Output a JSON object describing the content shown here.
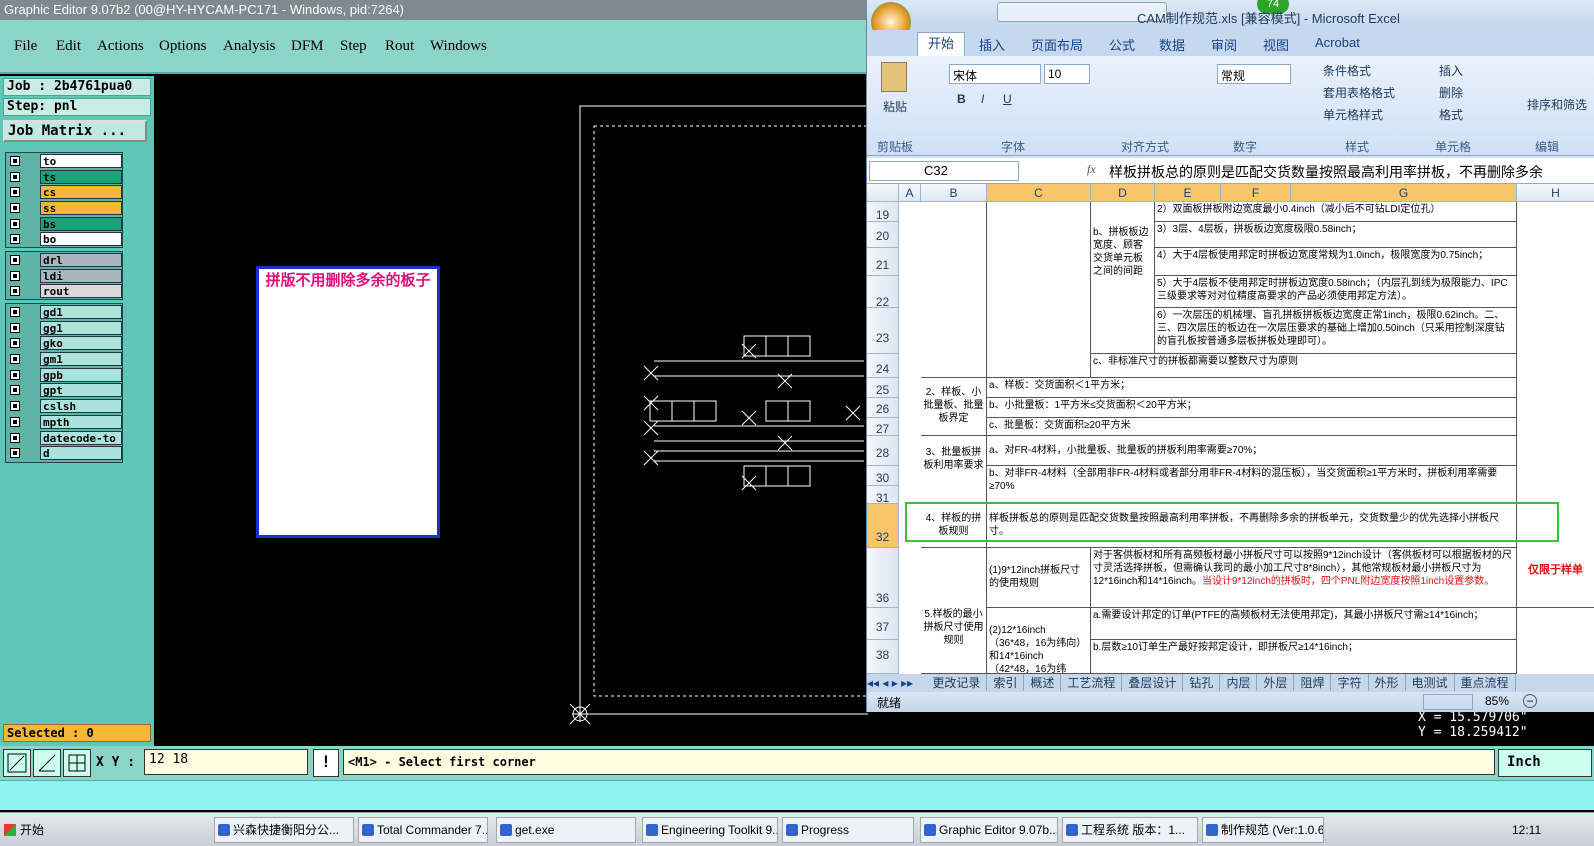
{
  "ge": {
    "title": "Graphic Editor 9.07b2 (00@HY-HYCAM-PC171 - Windows, pid:7264)",
    "menu": [
      "File",
      "Edit",
      "Actions",
      "Options",
      "Analysis",
      "DFM",
      "Step",
      "Rout",
      "Windows"
    ],
    "job": "Job : 2b4761pua0",
    "step": "Step: pnl",
    "job_matrix": "Job Matrix ...",
    "layers_group1": [
      {
        "name": "to",
        "color": "#ffffff"
      },
      {
        "name": "ts",
        "color": "#1aa37a"
      },
      {
        "name": "cs",
        "color": "#f5b836"
      },
      {
        "name": "ss",
        "color": "#f5b836"
      },
      {
        "name": "bs",
        "color": "#1aa37a"
      },
      {
        "name": "bo",
        "color": "#ffffff"
      }
    ],
    "layers_group2": [
      {
        "name": "drl",
        "color": "#a9b6bd"
      },
      {
        "name": "ldi",
        "color": "#a9b6bd"
      },
      {
        "name": "rout",
        "color": "#d8d8d8"
      }
    ],
    "layers_group3": [
      {
        "name": "gd1",
        "color": "#a9e3dc"
      },
      {
        "name": "gg1",
        "color": "#a9e3dc"
      },
      {
        "name": "gko",
        "color": "#a9e3dc"
      },
      {
        "name": "gm1",
        "color": "#a9e3dc"
      },
      {
        "name": "gpb",
        "color": "#a9e3dc"
      },
      {
        "name": "gpt",
        "color": "#a9e3dc"
      },
      {
        "name": "cslsh",
        "color": "#a9e3dc"
      },
      {
        "name": "mpth",
        "color": "#a9e3dc"
      },
      {
        "name": "datecode-to",
        "color": "#a9e3dc"
      },
      {
        "name": "d",
        "color": "#a9e3dc"
      }
    ],
    "selected": "Selected : 0",
    "note_text": "拼版不用删除多余的板子",
    "xy_label": "X Y :",
    "xy_value": "12  18",
    "prompt": "<M1> - Select first corner",
    "unit": "Inch",
    "coord_x": "X = 15.579706\"",
    "coord_y": "Y = 18.259412\""
  },
  "excel": {
    "title": "CAM制作规范.xls  [兼容模式] - Microsoft Excel",
    "badge": "74",
    "tabs": [
      "开始",
      "插入",
      "页面布局",
      "公式",
      "数据",
      "审阅",
      "视图",
      "Acrobat"
    ],
    "ribbon": {
      "paste": "粘贴",
      "font_name": "宋体",
      "font_size": "10",
      "number_format": "常规",
      "cond_format": "条件格式",
      "table_format": "套用表格格式",
      "cell_style": "单元格样式",
      "insert": "插入",
      "delete": "删除",
      "format": "格式",
      "sort_filter": "排序和筛选",
      "groups": [
        "剪贴板",
        "字体",
        "对齐方式",
        "数字",
        "样式",
        "单元格",
        "编辑"
      ]
    },
    "name_box": "C32",
    "formula": "样板拼板总的原则是匹配交货数量按照最高利用率拼板，不再删除多余",
    "columns": [
      "A",
      "B",
      "C",
      "D",
      "E",
      "F",
      "G",
      "H"
    ],
    "rows": [
      "19",
      "20",
      "21",
      "22",
      "23",
      "24",
      "25",
      "26",
      "27",
      "28",
      "30",
      "31",
      "32",
      "36",
      "37",
      "38"
    ],
    "cells": {
      "d_b_label": "b、拼板板边宽度、顾客交货单元板之间的间距",
      "r19": "2）双面板拼板附边宽度最小0.4inch（减小后不可钻LDI定位孔）",
      "r20": "3）3层、4层板，拼板板边宽度极限0.58inch；",
      "r21": "4）大于4层板使用邦定时拼板边宽度常规为1.0inch，极限宽度为0.75inch；",
      "r22": "5）大于4层板不使用邦定时拼板边宽度0.58inch；（内层孔到线为极限能力、IPC三级要求等对对位精度高要求的产品必须使用邦定方法）。",
      "r23": "6）一次层压的机械埋、盲孔拼板拼板板边宽度正常1inch，极限0.62inch。二、三、四次层压的板边在一次层压要求的基础上增加0.50inch（只采用控制深度钻的盲孔板按普通多层板拼板处理即可）。",
      "r24": "c、非标准尺寸的拼板都需要以整数尺寸为原则",
      "b25": "2、样板、小批量板、批量板界定",
      "r25": "a、样板：交货面积＜1平方米；",
      "r26": "b、小批量板：1平方米≤交货面积＜20平方米；",
      "r27": "c、批量板：交货面积≥20平方米",
      "b28": "3、批量板拼板利用率要求",
      "r28": "a、对FR-4材料，小批量板、批量板的拼板利用率需要≥70%；",
      "r30": "b、对非FR-4材料（全部用非FR-4材料或者部分用非FR-4材料的混压板），当交货面积≥1平方米时，拼板利用率需要≥70%",
      "b32": "4、样板的拼板规则",
      "r32": "样板拼板总的原则是匹配交货数量按照最高利用率拼板，不再删除多余的拼板单元，交货数量少的优先选择小拼板尺寸。",
      "b36": "5.样板的最小拼板尺寸使用规则",
      "c36": "(1)9*12inch拼板尺寸的使用规则",
      "r36a": "对于客供板材和所有高频板材最小拼板尺寸可以按照9*12inch设计（客供板材可以根据板材的尺寸灵活选择拼板，但需确认我司的最小加工尺寸8*8inch），其他常规板材最小拼板尺寸为12*16inch和14*16inch。",
      "r36b": "当设计9*12inch的拼板时，四个PNL附边宽度按照1inch设置参数。",
      "h36": "仅限于样单",
      "c37": "(2)12*16inch（36*48，16为纬向）和14*16inch（42*48，16为纬",
      "r37": "a.需要设计邦定的订单(PTFE的高频板材无法使用邦定)，其最小拼板尺寸需≥14*16inch；",
      "r38": "b.层数≥10订单生产最好按邦定设计，即拼板尺≥14*16inch；"
    },
    "sheet_tabs": [
      "更改记录",
      "索引",
      "概述",
      "工艺流程",
      "叠层设计",
      "钻孔",
      "内层",
      "外层",
      "阻焊",
      "字符",
      "外形",
      "电测试",
      "重点流程"
    ],
    "status": "就绪",
    "zoom": "85%"
  },
  "taskbar": {
    "start": "开始",
    "tasks": [
      "兴森快捷衡阳分公...",
      "Total Commander 7....",
      "get.exe",
      "Engineering Toolkit 9...",
      "Progress",
      "Graphic Editor 9.07b...",
      "工程系统  版本：1...",
      "制作规范 (Ver:1.0.6)"
    ],
    "clock": "12:11"
  }
}
